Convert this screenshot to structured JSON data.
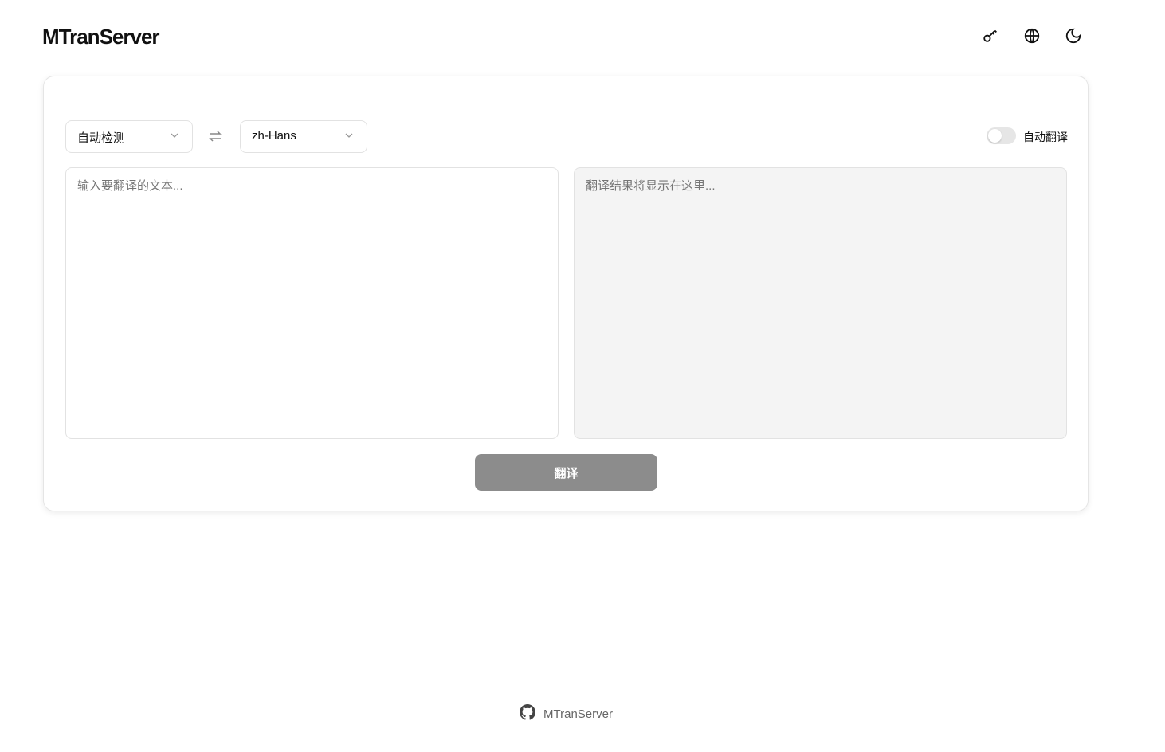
{
  "header": {
    "title": "MTranServer",
    "icons": [
      "key-icon",
      "globe-icon",
      "moon-icon"
    ]
  },
  "translator": {
    "source_lang": "自动检测",
    "target_lang": "zh-Hans",
    "auto_translate_label": "自动翻译",
    "input_placeholder": "输入要翻译的文本...",
    "output_placeholder": "翻译结果将显示在这里...",
    "translate_button": "翻译"
  },
  "footer": {
    "link": "MTranServer"
  }
}
